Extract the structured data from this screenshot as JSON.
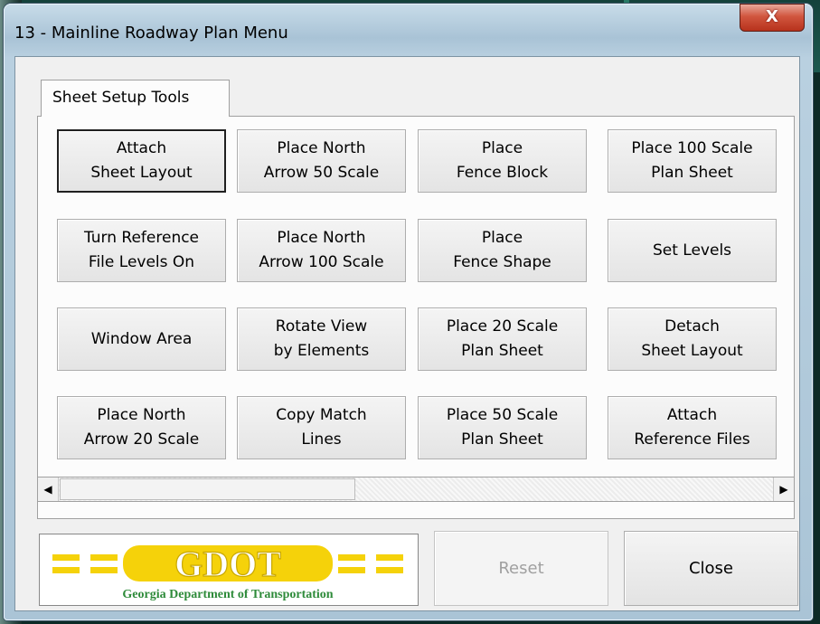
{
  "window": {
    "title": "13 - Mainline Roadway Plan Menu",
    "close_glyph": "X"
  },
  "tabs": [
    {
      "label": "Sheet Setup Tools",
      "active": true
    }
  ],
  "buttons": [
    {
      "label": "Attach\nSheet Layout"
    },
    {
      "label": "Place North\nArrow 50 Scale"
    },
    {
      "label": "Place\nFence Block"
    },
    {
      "label": "Place 100 Scale\nPlan Sheet"
    },
    {
      "label": "Turn Reference\nFile Levels On"
    },
    {
      "label": "Place North\nArrow 100 Scale"
    },
    {
      "label": "Place\nFence Shape"
    },
    {
      "label": "Set Levels"
    },
    {
      "label": "Window Area"
    },
    {
      "label": "Rotate View\nby Elements"
    },
    {
      "label": "Place 20 Scale\nPlan Sheet"
    },
    {
      "label": "Detach\nSheet Layout"
    },
    {
      "label": "Place North\nArrow 20 Scale"
    },
    {
      "label": "Copy Match\nLines"
    },
    {
      "label": "Place 50 Scale\nPlan Sheet"
    },
    {
      "label": "Attach\nReference Files"
    }
  ],
  "scrollbar": {
    "left_arrow": "◀",
    "right_arrow": "▶"
  },
  "logo": {
    "wordmark": "GDOT",
    "subtitle": "Georgia Department of Transportation",
    "colors": {
      "yellow": "#f5d20a",
      "green": "#2e8b3a"
    }
  },
  "footer": {
    "reset_label": "Reset",
    "close_label": "Close"
  }
}
